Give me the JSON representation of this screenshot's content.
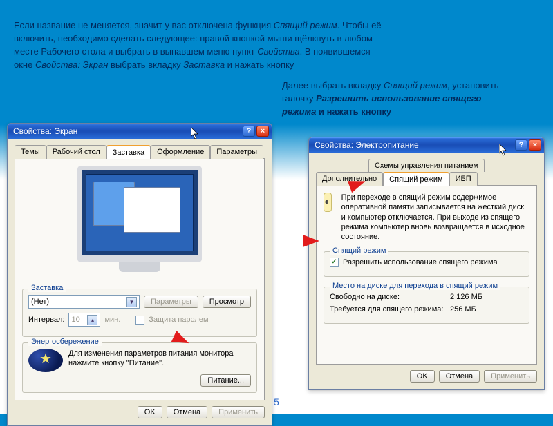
{
  "instruction_left": {
    "p1": "Если название не меняется, значит у вас отключена функция ",
    "p1_it": "Спящий режим",
    "p1b": ". Чтобы её включить, необходимо сделать следующее: правой кнопкой мыши щёлкнуть в любом месте Рабочего стола и выбрать в выпавшем меню пункт ",
    "p1b_it": "Свойства",
    "p1c": ". В появившемся окне ",
    "p1c_it": "Свойства: Экран",
    "p1d": " выбрать вкладку ",
    "p1d_it": "Заставка",
    "p1e": " и нажать кнопку "
  },
  "instruction_right": {
    "r1": "Далее выбрать вкладку ",
    "r1_it": "Спящий режим",
    "r2": ", установить галочку ",
    "r2_it": "Разрешить использование спящего режима",
    "r3": " и нажать кнопку"
  },
  "win1": {
    "title": "Свойства: Экран",
    "tabs": [
      "Темы",
      "Рабочий стол",
      "Заставка",
      "Оформление",
      "Параметры"
    ],
    "section_zastavka": "Заставка",
    "combo_value": "(Нет)",
    "btn_params": "Параметры",
    "btn_preview": "Просмотр",
    "interval_lbl": "Интервал:",
    "interval_val": "10",
    "interval_unit": "мин.",
    "protect_lbl": "Защита паролем",
    "power_section": "Энергосбережение",
    "power_text": "Для изменения параметров питания монитора нажмите кнопку \"Питание\".",
    "btn_power": "Питание...",
    "ok": "OK",
    "cancel": "Отмена",
    "apply": "Применить"
  },
  "win2": {
    "title": "Свойства: Электропитание",
    "tabs_top": [
      "Схемы управления питанием"
    ],
    "tabs_bottom": [
      "Дополнительно",
      "Спящий режим",
      "ИБП"
    ],
    "desc": "При переходе в спящий режим содержимое оперативной памяти записывается на жесткий диск и компьютер отключается. При выходе из спящего режима компьютер вновь возвращается в исходное состояние.",
    "section_sleep": "Спящий режим",
    "checkbox_lbl": "Разрешить использование спящего режима",
    "section_disk": "Место на диске для перехода в спящий режим",
    "free_lbl": "Свободно на диске:",
    "free_val": "2 126 МБ",
    "need_lbl": "Требуется для спящего режима:",
    "need_val": "256 МБ",
    "ok": "OK",
    "cancel": "Отмена",
    "apply": "Применить"
  },
  "page_number": "5"
}
